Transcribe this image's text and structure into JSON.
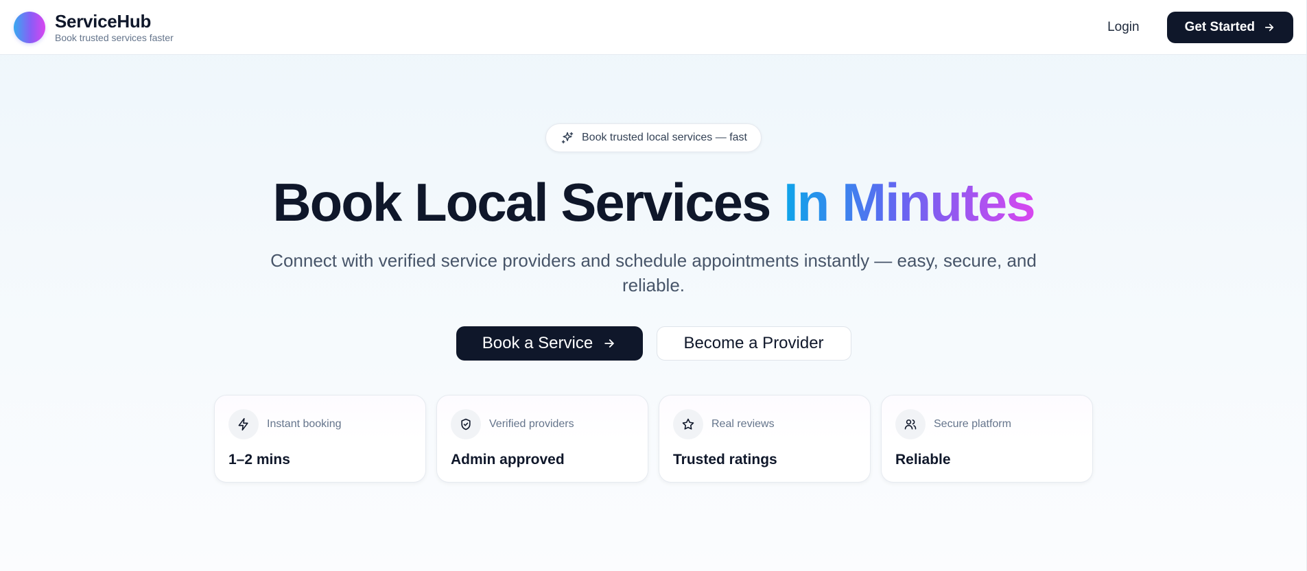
{
  "brand": {
    "name": "ServiceHub",
    "tagline": "Book trusted services faster"
  },
  "nav": {
    "login_label": "Login",
    "get_started_label": "Get Started"
  },
  "hero": {
    "pill_text": "Book trusted local services — fast",
    "headline_main": "Book Local Services ",
    "headline_accent": "In Minutes",
    "subtitle": "Connect with verified service providers and schedule appointments instantly — easy, secure, and reliable.",
    "primary_cta": "Book a Service",
    "secondary_cta": "Become a Provider"
  },
  "features": [
    {
      "icon": "lightning-icon",
      "label": "Instant booking",
      "value": "1–2 mins"
    },
    {
      "icon": "shield-check-icon",
      "label": "Verified providers",
      "value": "Admin approved"
    },
    {
      "icon": "star-icon",
      "label": "Real reviews",
      "value": "Trusted ratings"
    },
    {
      "icon": "users-icon",
      "label": "Secure platform",
      "value": "Reliable"
    }
  ],
  "colors": {
    "primary": "#0f172a",
    "accent_start": "#0ea5e9",
    "accent_mid": "#6366f1",
    "accent_end": "#d946ef"
  }
}
